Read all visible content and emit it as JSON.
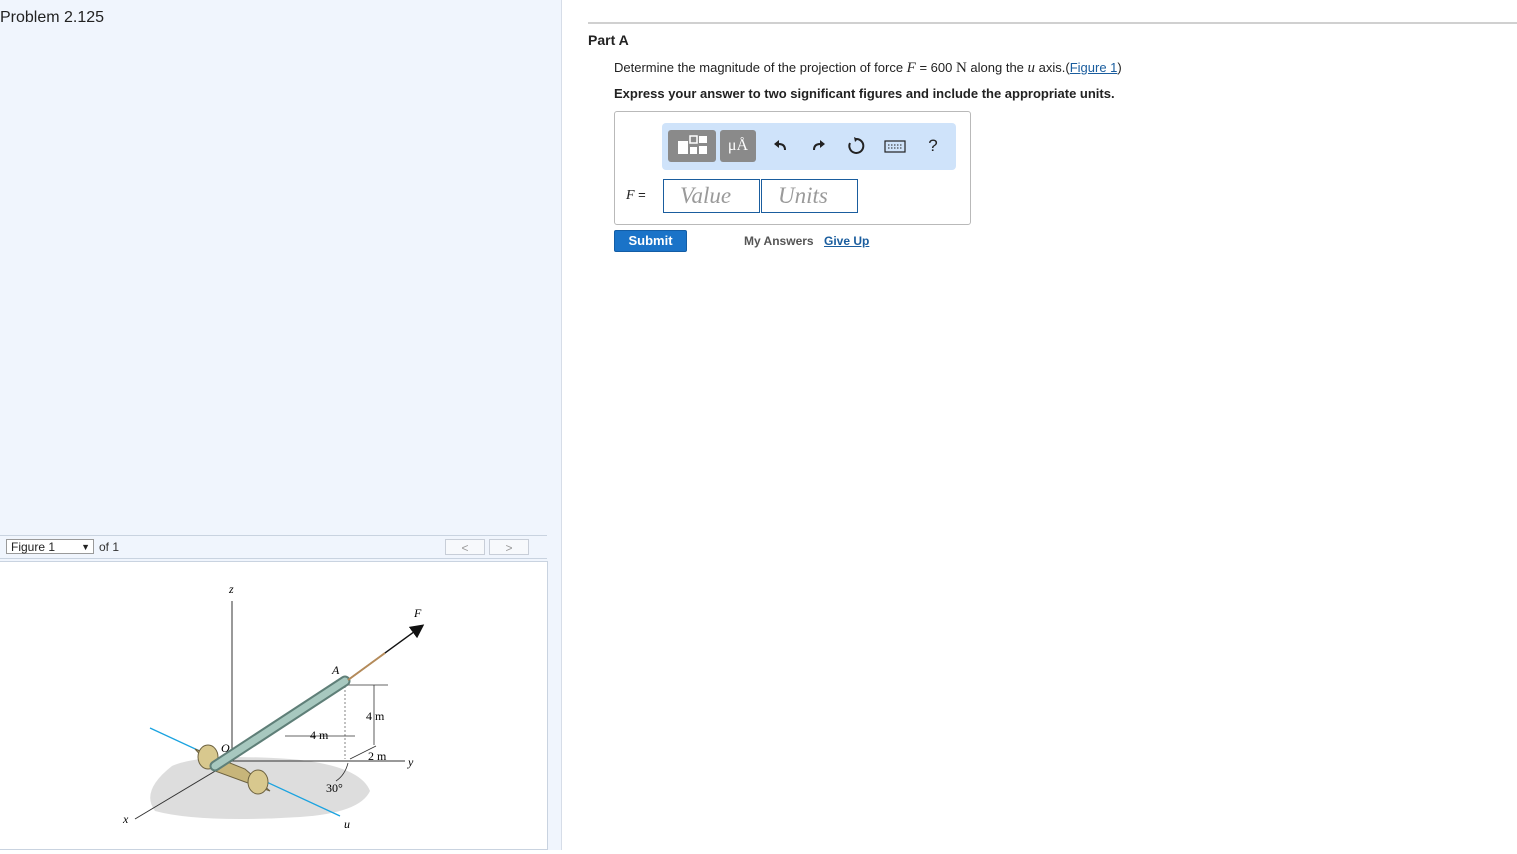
{
  "problem": {
    "title": "Problem 2.125"
  },
  "figure_nav": {
    "selected": "Figure 1",
    "of_text": "of 1",
    "prev_label": "<",
    "next_label": ">"
  },
  "figure": {
    "labels": {
      "z": "z",
      "x": "x",
      "y": "y",
      "u": "u",
      "F": "F",
      "A": "A",
      "O": "O",
      "dim_4m_vertical": "4 m",
      "dim_4m_horizontal": "4 m",
      "dim_2m": "2 m",
      "angle": "30°"
    }
  },
  "part": {
    "title": "Part A",
    "question_pre": "Determine the magnitude of the projection of force ",
    "question_sym": "F",
    "question_eq": " = 600 ",
    "question_unit": "N",
    "question_mid": " along the ",
    "question_axis": "u",
    "question_post": " axis.",
    "figure_link_open": "(",
    "figure_link": "Figure 1",
    "figure_link_close": ")",
    "instruction": "Express your answer to two significant figures and include the appropriate units."
  },
  "toolbar": {
    "units_button": "μÅ",
    "help": "?",
    "icons": [
      "templates-icon",
      "units-icon",
      "undo-icon",
      "redo-icon",
      "reset-icon",
      "keyboard-icon",
      "help-icon"
    ]
  },
  "answer": {
    "label_sym": "F",
    "label_eq": " =",
    "value_placeholder": "Value",
    "units_placeholder": "Units"
  },
  "actions": {
    "submit": "Submit",
    "my_answers": "My Answers",
    "give_up": "Give Up"
  },
  "colors": {
    "left_bg": "#f0f5fd",
    "toolbar_bg": "#cfe3fa",
    "submit_bg": "#1a73c8",
    "link": "#1a5d9e",
    "u_axis": "#1aa3e0",
    "rod": "#8bb5a8"
  }
}
